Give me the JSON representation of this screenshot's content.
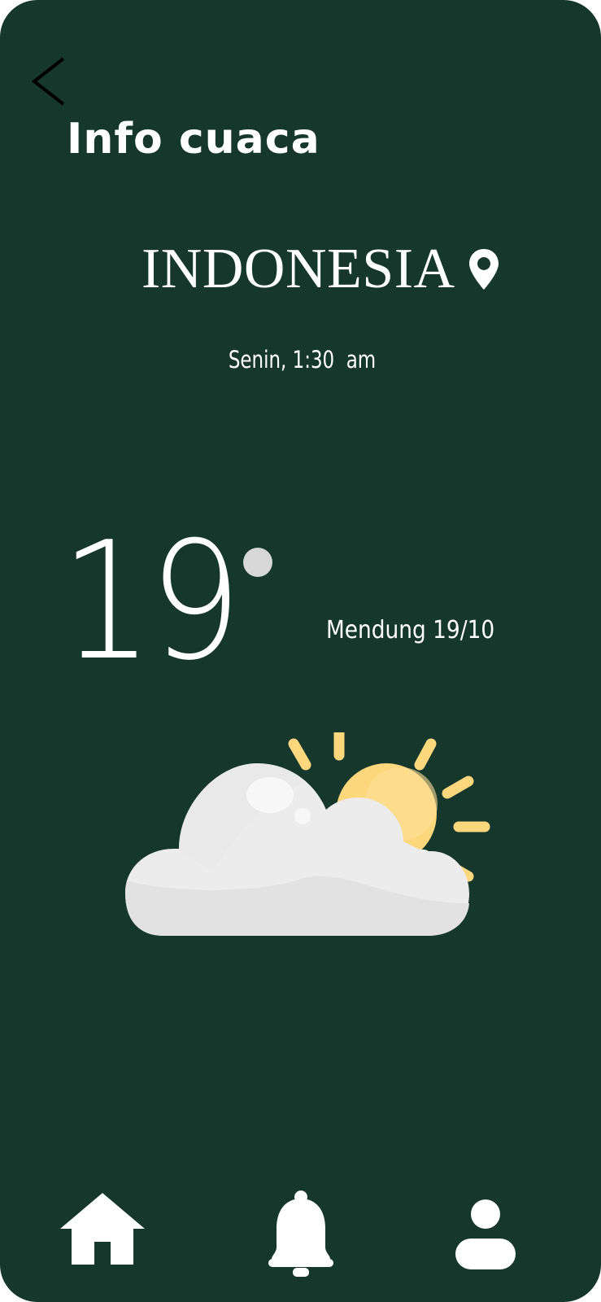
{
  "header": {
    "title": "Info cuaca",
    "back_icon": "chevron-left-icon"
  },
  "location": {
    "name": "INDONESIA",
    "icon": "map-pin-icon"
  },
  "datetime": "Senin, 1:30  am",
  "weather": {
    "temperature": "19",
    "degree_icon": "degree-dot-icon",
    "condition": "Mendung 19/10",
    "illustration": "partly-cloudy-icon"
  },
  "bottom_nav": {
    "items": [
      {
        "icon": "home-icon"
      },
      {
        "icon": "bell-icon"
      },
      {
        "icon": "profile-icon"
      }
    ]
  },
  "colors": {
    "background": "#15372c",
    "text": "#ffffff",
    "sun": "#fdd77c",
    "cloud": "#ececec"
  }
}
